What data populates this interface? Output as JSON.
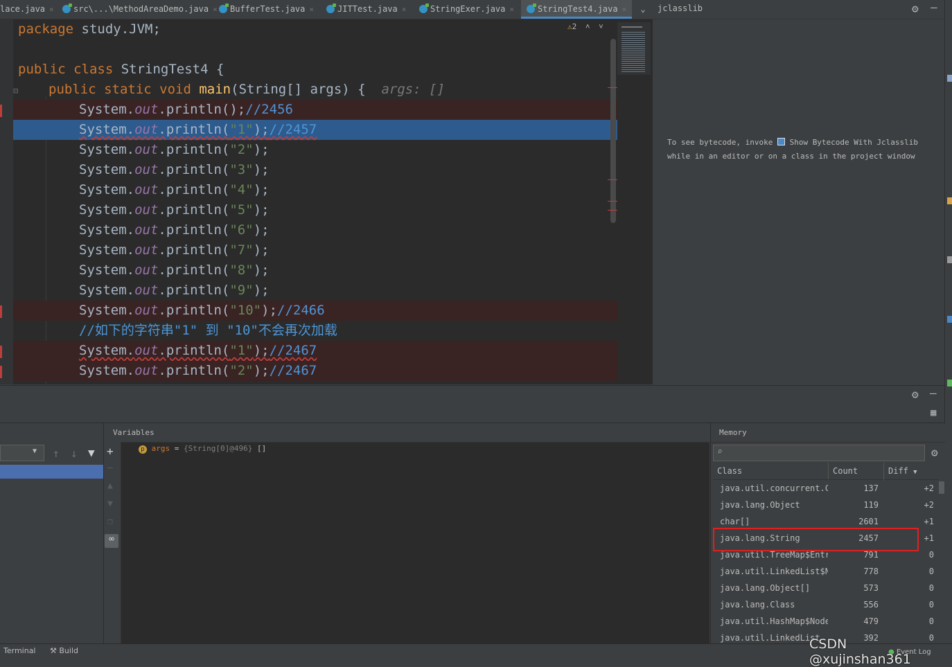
{
  "tabs": [
    {
      "label": "lace.java"
    },
    {
      "label": "src\\...\\MethodAreaDemo.java"
    },
    {
      "label": "BufferTest.java"
    },
    {
      "label": "JITTest.java"
    },
    {
      "label": "StringExer.java"
    },
    {
      "label": "StringTest4.java"
    }
  ],
  "jclasslib": {
    "title": "jclasslib",
    "hint_line1a": "To see bytecode, invoke ",
    "hint_line1b": " Show Bytecode With Jclasslib",
    "hint_line2": "while in an editor or on a class in the project window"
  },
  "editor": {
    "warning_count": "2",
    "lines": [
      {
        "p1": "package",
        "p2": " study.JVM;"
      },
      {
        "p1": "public class",
        "p2": " StringTest4 {"
      },
      {
        "p1": "public static void",
        "p2": "main",
        "p3": "(String[] args) {",
        "hint": "args: []"
      },
      {
        "obj": "System.",
        "fld": "out",
        "call": ".println();",
        "cmt": "//2456"
      },
      {
        "obj": "System.",
        "fld": "out",
        "call": ".println(",
        "str": "\"1\"",
        "end": ");",
        "cmt": "//2457"
      },
      {
        "obj": "System.",
        "fld": "out",
        "call": ".println(",
        "str": "\"2\"",
        "end": ");"
      },
      {
        "obj": "System.",
        "fld": "out",
        "call": ".println(",
        "str": "\"3\"",
        "end": ");"
      },
      {
        "obj": "System.",
        "fld": "out",
        "call": ".println(",
        "str": "\"4\"",
        "end": ");"
      },
      {
        "obj": "System.",
        "fld": "out",
        "call": ".println(",
        "str": "\"5\"",
        "end": ");"
      },
      {
        "obj": "System.",
        "fld": "out",
        "call": ".println(",
        "str": "\"6\"",
        "end": ");"
      },
      {
        "obj": "System.",
        "fld": "out",
        "call": ".println(",
        "str": "\"7\"",
        "end": ");"
      },
      {
        "obj": "System.",
        "fld": "out",
        "call": ".println(",
        "str": "\"8\"",
        "end": ");"
      },
      {
        "obj": "System.",
        "fld": "out",
        "call": ".println(",
        "str": "\"9\"",
        "end": ");"
      },
      {
        "obj": "System.",
        "fld": "out",
        "call": ".println(",
        "str": "\"10\"",
        "end": ");",
        "cmt": "//2466"
      },
      {
        "comment": "//如下的字符串\"1\" 到 \"10\"不会再次加载"
      },
      {
        "obj": "System.",
        "fld": "out",
        "call": ".println(",
        "str": "\"1\"",
        "end": ");",
        "cmt": "//2467"
      },
      {
        "obj": "System.",
        "fld": "out",
        "call": ".println(",
        "str": "\"2\"",
        "end": ");",
        "cmt": "//2467"
      }
    ]
  },
  "variables": {
    "title": "Variables",
    "items": [
      {
        "badge": "p",
        "name": "args",
        "eq": " = ",
        "type": "{String[0]@496}",
        "value": "[]"
      }
    ]
  },
  "memory": {
    "title": "Memory",
    "columns": [
      "Class",
      "Count",
      "Diff"
    ],
    "rows": [
      {
        "cls": "java.util.concurrent.C",
        "count": "137",
        "diff": "+2"
      },
      {
        "cls": "java.lang.Object",
        "count": "119",
        "diff": "+2"
      },
      {
        "cls": "char[]",
        "count": "2601",
        "diff": "+1"
      },
      {
        "cls": "java.lang.String",
        "count": "2457",
        "diff": "+1"
      },
      {
        "cls": "java.util.TreeMap$Entr",
        "count": "791",
        "diff": "0"
      },
      {
        "cls": "java.util.LinkedList$N",
        "count": "778",
        "diff": "0"
      },
      {
        "cls": "java.lang.Object[]",
        "count": "573",
        "diff": "0"
      },
      {
        "cls": "java.lang.Class",
        "count": "556",
        "diff": "0"
      },
      {
        "cls": "java.util.HashMap$Node",
        "count": "479",
        "diff": "0"
      },
      {
        "cls": "java.util.LinkedList",
        "count": "392",
        "diff": "0"
      }
    ],
    "highlight_color": "#e02020"
  },
  "status": {
    "terminal": "Terminal",
    "build": "Build",
    "event_log": "Event Log",
    "watermark": "CSDN @xujinshan361"
  }
}
